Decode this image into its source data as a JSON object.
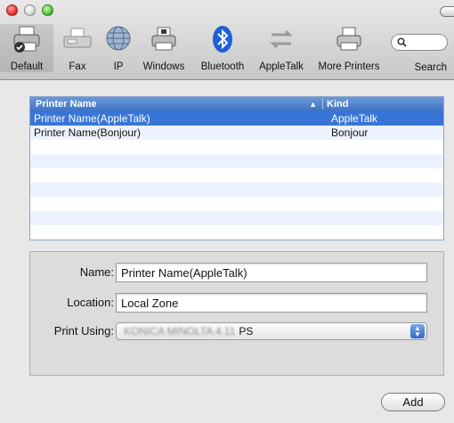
{
  "toolbar": {
    "items": [
      {
        "label": "Default",
        "icon": "printer-default-icon"
      },
      {
        "label": "Fax",
        "icon": "fax-icon"
      },
      {
        "label": "IP",
        "icon": "globe-icon"
      },
      {
        "label": "Windows",
        "icon": "windows-printer-icon"
      },
      {
        "label": "Bluetooth",
        "icon": "bluetooth-icon"
      },
      {
        "label": "AppleTalk",
        "icon": "appletalk-icon"
      },
      {
        "label": "More Printers",
        "icon": "more-printers-icon"
      },
      {
        "label": "Search",
        "icon": "search-icon"
      }
    ],
    "selected": "Default"
  },
  "list": {
    "columns": {
      "name": "Printer Name",
      "kind": "Kind"
    },
    "rows": [
      {
        "name": "Printer Name(AppleTalk)",
        "kind": "AppleTalk",
        "selected": true
      },
      {
        "name": "Printer Name(Bonjour)",
        "kind": "Bonjour",
        "selected": false
      }
    ]
  },
  "details": {
    "name_label": "Name:",
    "name_value": "Printer Name(AppleTalk)",
    "location_label": "Location:",
    "location_value": "Local Zone",
    "print_using_label": "Print Using:",
    "print_using_value_blurred": "KONICA MINOLTA 4.11",
    "print_using_value": "PS"
  },
  "add_button": "Add",
  "colors": {
    "selection": "#3875d7",
    "header": "#4c80cf",
    "alt_row": "#edf3fe"
  }
}
